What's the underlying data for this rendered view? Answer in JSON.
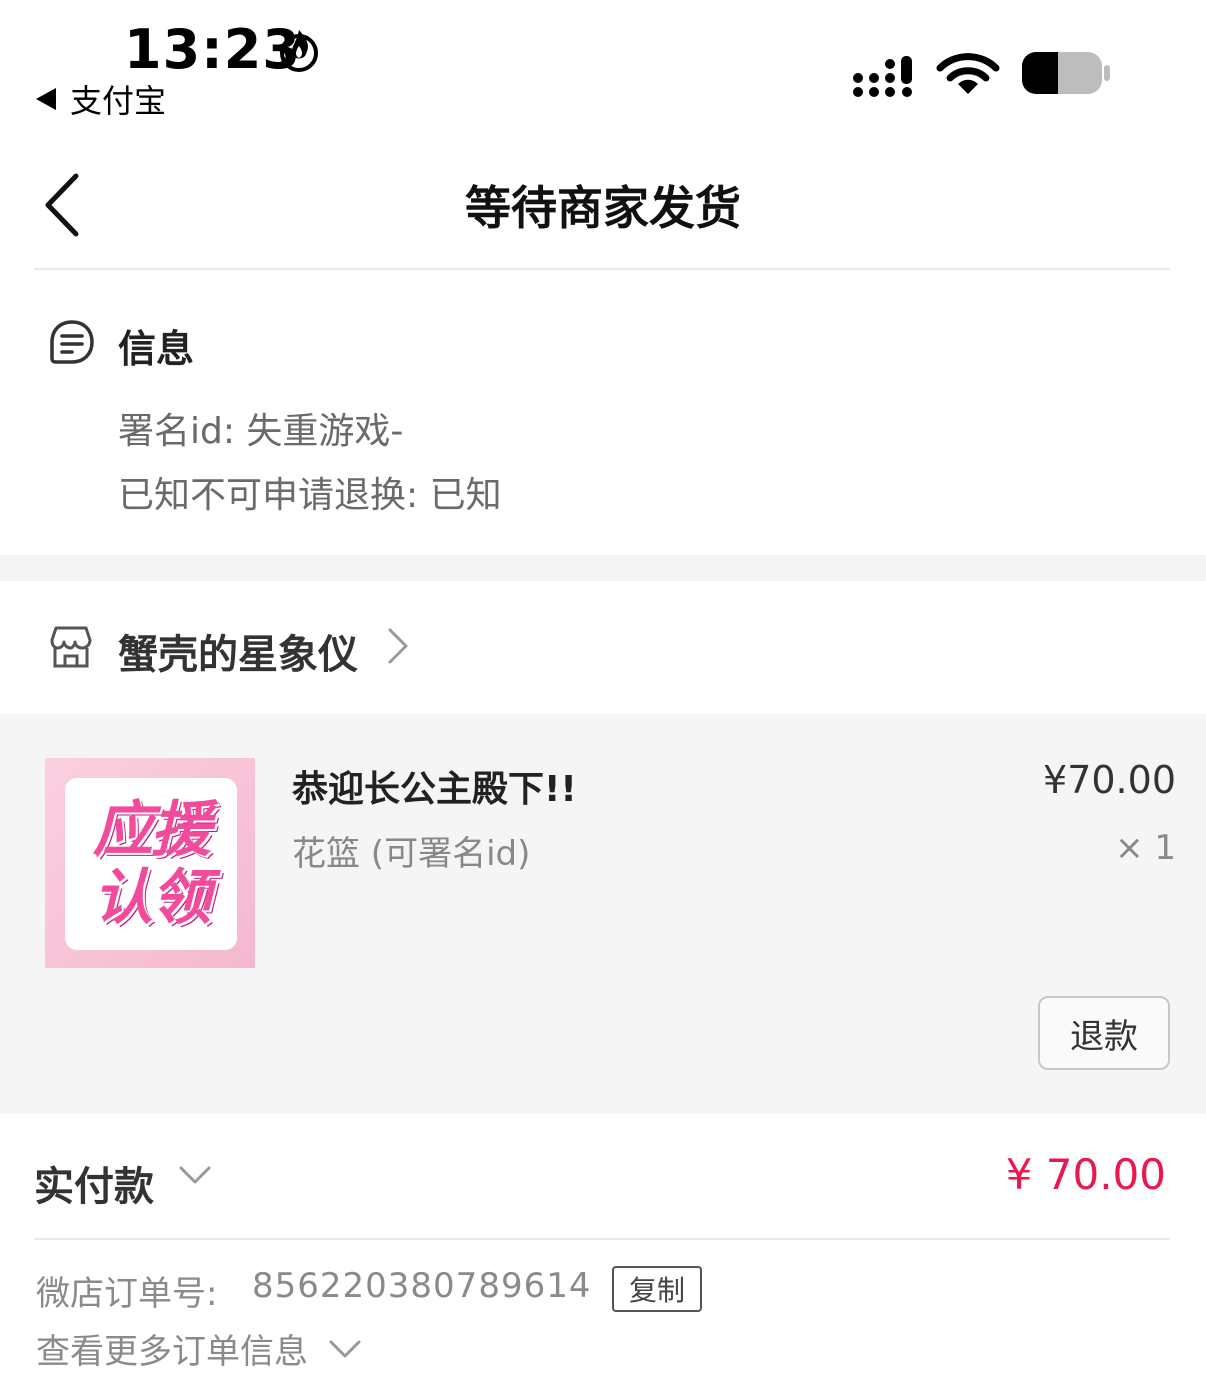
{
  "status_bar": {
    "time": "13:23",
    "back_app": "支付宝"
  },
  "header": {
    "title": "等待商家发货"
  },
  "info": {
    "heading": "信息",
    "lines": [
      "署名id: 失重游戏-",
      "已知不可申请退换: 已知"
    ]
  },
  "store": {
    "name": "蟹壳的星象仪"
  },
  "product": {
    "thumb_text": [
      "应援",
      "认领"
    ],
    "title": "恭迎长公主殿下!!",
    "spec": "花篮 (可署名id)",
    "price": "¥70.00",
    "quantity": "× 1",
    "refund_label": "退款"
  },
  "payment": {
    "paid_label": "实付款",
    "paid_amount": "¥ 70.00",
    "order_label": "微店订单号:",
    "order_number": "856220380789614",
    "copy_label": "复制",
    "more_info_label": "查看更多订单信息"
  },
  "colors": {
    "accent_red": "#e8194f",
    "thumb_pink": "#f24b9c"
  },
  "icons": {
    "status": [
      "fire-icon",
      "signal-icon",
      "wifi-icon",
      "battery-icon"
    ],
    "header": [
      "back-arrow-icon"
    ],
    "info": [
      "message-note-icon"
    ],
    "store": [
      "shop-icon",
      "chevron-right-icon"
    ],
    "payment": [
      "chevron-down-icon"
    ]
  }
}
